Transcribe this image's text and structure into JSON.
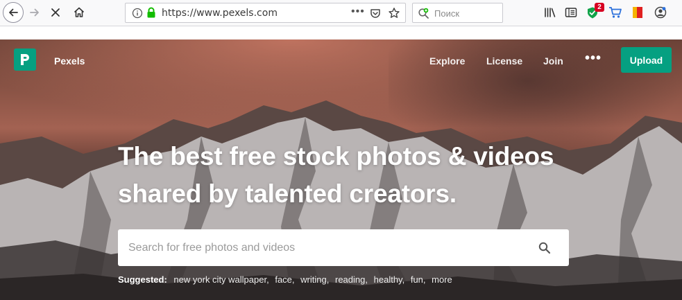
{
  "browser": {
    "url": "https://www.pexels.com",
    "search_placeholder": "Поиск",
    "more_dots": "•••",
    "extension_badge_count": "2",
    "icons": {
      "back": "back-arrow-icon",
      "forward": "forward-arrow-icon",
      "stop": "stop-icon",
      "home": "home-icon",
      "info": "info-icon",
      "lock": "lock-icon",
      "pocket": "pocket-icon",
      "bookmark": "star-icon",
      "library": "library-icon",
      "reader": "reader-view-icon",
      "shield_extension": "shield-extension-icon",
      "cart": "cart-icon",
      "flag": "flag-extension-icon",
      "account": "account-icon"
    }
  },
  "site": {
    "brand": "Pexels",
    "accent_color": "#05a081",
    "nav": {
      "explore": "Explore",
      "license": "License",
      "join": "Join",
      "more": "•••",
      "upload": "Upload"
    },
    "hero": {
      "headline_line1": "The best free stock photos & videos",
      "headline_line2": "shared by talented creators.",
      "search_placeholder": "Search for free photos and videos",
      "suggested_label": "Suggested:",
      "suggestions": [
        "new york city wallpaper",
        "face",
        "writing",
        "reading",
        "healthy",
        "fun",
        "more"
      ]
    }
  }
}
